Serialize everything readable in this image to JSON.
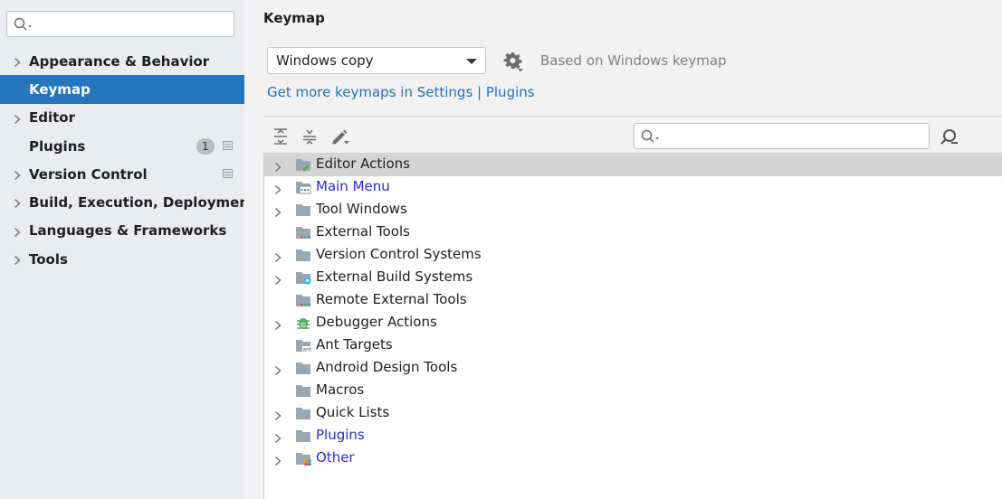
{
  "sidebar": {
    "search": {
      "placeholder": "",
      "value": ""
    },
    "items": [
      {
        "label": "Appearance & Behavior",
        "expandable": true,
        "selected": false
      },
      {
        "label": "Keymap",
        "expandable": false,
        "selected": true
      },
      {
        "label": "Editor",
        "expandable": true,
        "selected": false
      },
      {
        "label": "Plugins",
        "expandable": false,
        "selected": false,
        "badge": "1",
        "project_icon": true
      },
      {
        "label": "Version Control",
        "expandable": true,
        "selected": false,
        "project_icon": true
      },
      {
        "label": "Build, Execution, Deployment",
        "expandable": true,
        "selected": false
      },
      {
        "label": "Languages & Frameworks",
        "expandable": true,
        "selected": false
      },
      {
        "label": "Tools",
        "expandable": true,
        "selected": false
      }
    ]
  },
  "main": {
    "title": "Keymap",
    "keymap_select": {
      "value": "Windows copy"
    },
    "based_on": "Based on Windows keymap",
    "more_link": "Get more keymaps in Settings | Plugins",
    "toolbar": {
      "expand_all_icon": "expand-all-icon",
      "collapse_all_icon": "collapse-all-icon",
      "edit_icon": "pencil-icon",
      "find_shortcut_icon": "find-by-shortcut-icon"
    },
    "filter_search": {
      "placeholder": "",
      "value": ""
    }
  },
  "tree": [
    {
      "label": "Editor Actions",
      "expandable": true,
      "icon": "folder-edit-icon",
      "selected": true,
      "blue": false
    },
    {
      "label": "Main Menu",
      "expandable": true,
      "icon": "folder-menu-icon",
      "selected": false,
      "blue": true
    },
    {
      "label": "Tool Windows",
      "expandable": true,
      "icon": "folder-icon",
      "selected": false,
      "blue": false
    },
    {
      "label": "External Tools",
      "expandable": false,
      "icon": "folder-tools-icon",
      "selected": false,
      "blue": false
    },
    {
      "label": "Version Control Systems",
      "expandable": true,
      "icon": "folder-icon",
      "selected": false,
      "blue": false
    },
    {
      "label": "External Build Systems",
      "expandable": true,
      "icon": "folder-gear-icon",
      "selected": false,
      "blue": false
    },
    {
      "label": "Remote External Tools",
      "expandable": false,
      "icon": "folder-tools-icon",
      "selected": false,
      "blue": false
    },
    {
      "label": "Debugger Actions",
      "expandable": true,
      "icon": "bug-icon",
      "selected": false,
      "blue": false
    },
    {
      "label": "Ant Targets",
      "expandable": false,
      "icon": "folder-ant-icon",
      "selected": false,
      "blue": false
    },
    {
      "label": "Android Design Tools",
      "expandable": true,
      "icon": "folder-icon",
      "selected": false,
      "blue": false
    },
    {
      "label": "Macros",
      "expandable": false,
      "icon": "folder-icon",
      "selected": false,
      "blue": false
    },
    {
      "label": "Quick Lists",
      "expandable": true,
      "icon": "folder-icon",
      "selected": false,
      "blue": false
    },
    {
      "label": "Plugins",
      "expandable": true,
      "icon": "folder-icon",
      "selected": false,
      "blue": true
    },
    {
      "label": "Other",
      "expandable": true,
      "icon": "folder-other-icon",
      "selected": false,
      "blue": true
    }
  ],
  "colors": {
    "selection": "#2675bf",
    "link": "#2470b3",
    "blue_node": "#2a2bd6",
    "folder": "#9aa7b0"
  }
}
